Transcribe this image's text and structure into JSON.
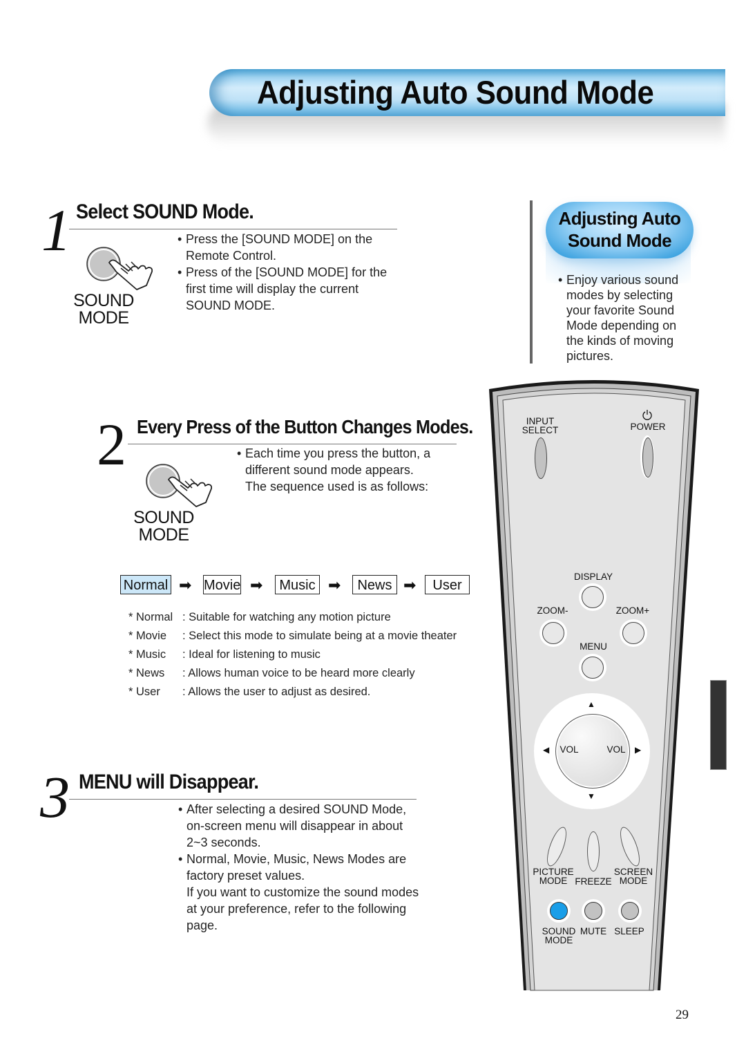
{
  "page": {
    "title": "Adjusting Auto Sound Mode",
    "page_number": "29",
    "accent_color": "#8ccbee",
    "highlight_color": "#1a9ee8"
  },
  "steps": [
    {
      "number": "1",
      "title": "Select SOUND Mode.",
      "icon": "hand-pressing-button-icon",
      "icon_label": [
        "SOUND",
        "MODE"
      ],
      "lines": [
        {
          "bullet": true,
          "text": "Press the [SOUND MODE] on the"
        },
        {
          "bullet": false,
          "text": "Remote Control."
        },
        {
          "bullet": true,
          "text": "Press of the [SOUND MODE] for the"
        },
        {
          "bullet": false,
          "text": "first time will display the current"
        },
        {
          "bullet": false,
          "text": "SOUND MODE."
        }
      ]
    },
    {
      "number": "2",
      "title": "Every Press of the Button Changes Modes.",
      "icon": "hand-pressing-button-icon",
      "icon_label": [
        "SOUND",
        "MODE"
      ],
      "lines": [
        {
          "bullet": true,
          "text": "Each time you press the button, a"
        },
        {
          "bullet": false,
          "text": "different sound mode appears."
        },
        {
          "bullet": false,
          "text": "The sequence used is as follows:"
        }
      ]
    },
    {
      "number": "3",
      "title": "MENU will Disappear.",
      "lines": [
        {
          "bullet": true,
          "text": "After selecting a desired SOUND Mode,"
        },
        {
          "bullet": false,
          "text": "on-screen menu will disappear in about"
        },
        {
          "bullet": false,
          "text": "2~3 seconds."
        },
        {
          "bullet": true,
          "text": "Normal, Movie, Music, News Modes are"
        },
        {
          "bullet": false,
          "text": "factory preset values."
        },
        {
          "bullet": false,
          "text": "If you want to customize the sound modes"
        },
        {
          "bullet": false,
          "text": "at your preference, refer to the following"
        },
        {
          "bullet": false,
          "text": "page."
        }
      ]
    }
  ],
  "sequence": {
    "modes": [
      "Normal",
      "Movie",
      "Music",
      "News",
      "User"
    ],
    "active": "Normal",
    "arrow": "➡"
  },
  "descriptions": [
    {
      "mode": "* Normal",
      "text": ": Suitable for watching any motion picture"
    },
    {
      "mode": "* Movie",
      "text": ": Select this mode to simulate being at a movie theater"
    },
    {
      "mode": "* Music",
      "text": ": Ideal for listening to music"
    },
    {
      "mode": "* News",
      "text": ": Allows human voice to be heard more clearly"
    },
    {
      "mode": "* User",
      "text": ": Allows the user to adjust as desired."
    }
  ],
  "sidebar": {
    "heading_line1": "Adjusting Auto",
    "heading_line2": "Sound Mode",
    "lines": [
      "Enjoy various sound",
      "modes by selecting",
      "your favorite Sound",
      "Mode depending on",
      "the kinds of moving",
      "pictures."
    ]
  },
  "remote": {
    "input_select": [
      "INPUT",
      "SELECT"
    ],
    "power": "POWER",
    "display": "DISPLAY",
    "zoom_minus": "ZOOM-",
    "zoom_plus": "ZOOM+",
    "menu": "MENU",
    "vol_left": "VOL",
    "vol_right": "VOL",
    "picture_mode": [
      "PICTURE",
      "MODE"
    ],
    "freeze": "FREEZE",
    "screen_mode": [
      "SCREEN",
      "MODE"
    ],
    "sound_mode": [
      "SOUND",
      "MODE"
    ],
    "mute": "MUTE",
    "sleep": "SLEEP"
  }
}
